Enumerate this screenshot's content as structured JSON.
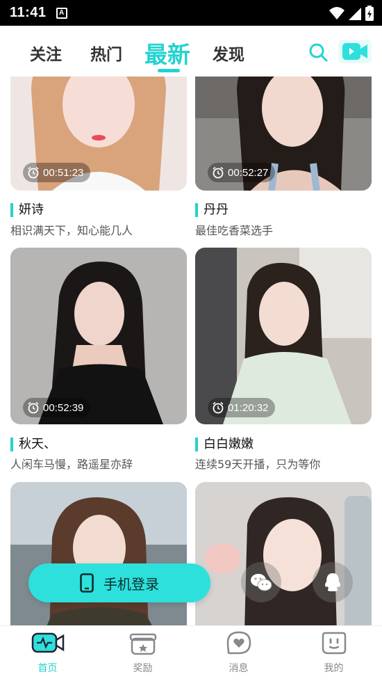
{
  "status_bar": {
    "time": "11:41",
    "notif_letter": "A"
  },
  "top_nav": {
    "tabs": [
      {
        "label": "关注",
        "active": false
      },
      {
        "label": "热门",
        "active": false
      },
      {
        "label": "最新",
        "active": true
      },
      {
        "label": "发现",
        "active": false
      }
    ],
    "accent": "#22d3d0"
  },
  "feed": {
    "cards": [
      {
        "duration": "00:51:23",
        "name": "妍诗",
        "signature": "相识满天下，知心能几人"
      },
      {
        "duration": "00:52:27",
        "name": "丹丹",
        "signature": "最佳吃香菜选手"
      },
      {
        "duration": "00:52:39",
        "name": "秋天、",
        "signature": "人闲车马慢，路遥星亦辞"
      },
      {
        "duration": "01:20:32",
        "name": "白白嫩嫩",
        "signature": "连续59天开播，只为等你"
      },
      {
        "duration": "",
        "name": "",
        "signature": ""
      },
      {
        "duration": "",
        "name": "",
        "signature": ""
      }
    ]
  },
  "login": {
    "phone_label": "手机登录"
  },
  "bottom_nav": {
    "items": [
      {
        "label": "首页",
        "icon": "home-live-icon",
        "active": true
      },
      {
        "label": "奖励",
        "icon": "gift-icon",
        "active": false
      },
      {
        "label": "消息",
        "icon": "message-heart-icon",
        "active": false
      },
      {
        "label": "我的",
        "icon": "profile-face-icon",
        "active": false
      }
    ]
  }
}
